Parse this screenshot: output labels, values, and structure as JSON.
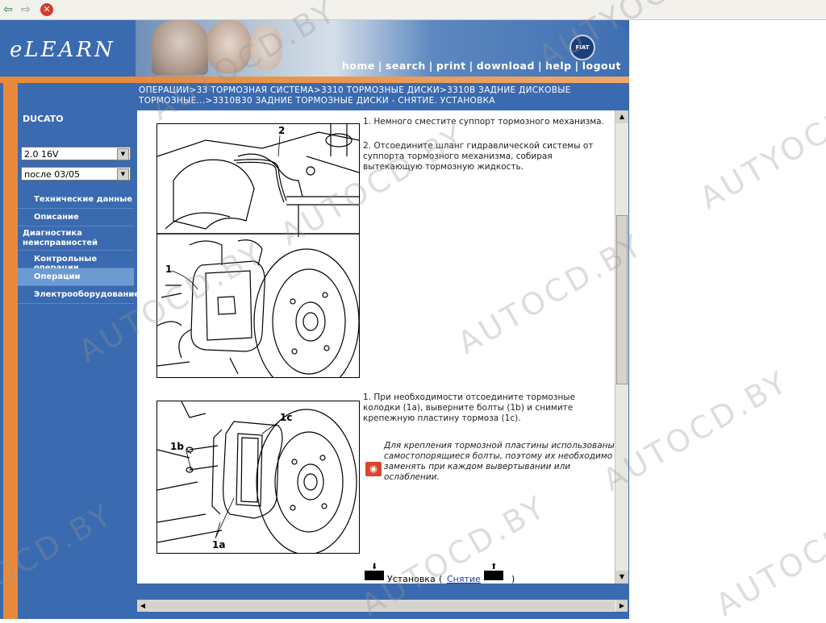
{
  "toolbar": {
    "back_icon": "back-arrow-icon",
    "forward_icon": "forward-arrow-icon",
    "stop_icon": "stop-icon"
  },
  "header": {
    "logo": "eLEARN",
    "badge": "FIAT",
    "nav": [
      "home",
      "search",
      "print",
      "download",
      "help",
      "logout"
    ]
  },
  "breadcrumb": "ОПЕРАЦИИ>33 ТОРМОЗНАЯ СИСТЕМА>3310 ТОРМОЗНЫЕ ДИСКИ>3310В ЗАДНИЕ ДИСКОВЫЕ ТОРМОЗНЫЕ...>3310В30 ЗАДНИЕ ТОРМОЗНЫЕ ДИСКИ - СНЯТИЕ. УСТАНОВКА",
  "sidebar": {
    "model": "DUCATO",
    "engine_select": "2.0 16V",
    "date_select": "после 03/05",
    "items": [
      {
        "label": "Технические данные",
        "active": false
      },
      {
        "label": "Описание",
        "active": false
      },
      {
        "label": "Диагностика неисправностей",
        "active": false
      },
      {
        "label": "Контрольные операции",
        "active": false
      },
      {
        "label": "Операции",
        "active": true
      },
      {
        "label": "Электрооборудование",
        "active": false
      }
    ]
  },
  "content": {
    "figure1_labels": [
      "2",
      "1"
    ],
    "figure2_labels": [
      "1c",
      "1b",
      "1a"
    ],
    "step1": "1. Немного сместите суппорт тормозного механизма.",
    "step2": "2. Отсоедините шланг гидравлической системы от суппорта тормозного механизма, собирая вытекающую тормозную жидкость.",
    "step3": "1. При необходимости отсоедините тормозные колодки (1а), выверните болты (1b) и снимите крепежную пластину тормоза (1c).",
    "note": "Для крепления тормозной пластины использованы самостопорящиеся болты, поэтому их необходимо заменять при каждом вывертывании или ослаблении.",
    "bottom_nav": {
      "install_label": "Установка",
      "paren_open": "(",
      "removal_link": "Снятие",
      "paren_close": ")"
    }
  },
  "watermark": [
    "AUTOCD.BY",
    "AUTYOCD.BY",
    "AUTOCD.BY",
    "AUTOCD.BY",
    "AUTOCD.BY",
    "AUTOCD.BY",
    "OCD.BY",
    "AUTOCD.BY",
    "AUTYOC",
    "AUTOCD.BY"
  ],
  "colors": {
    "frame_blue": "#3a6ab0",
    "accent_orange": "#e88a3c",
    "active_menu": "#6e9ad3",
    "warning_red": "#d8462c"
  }
}
